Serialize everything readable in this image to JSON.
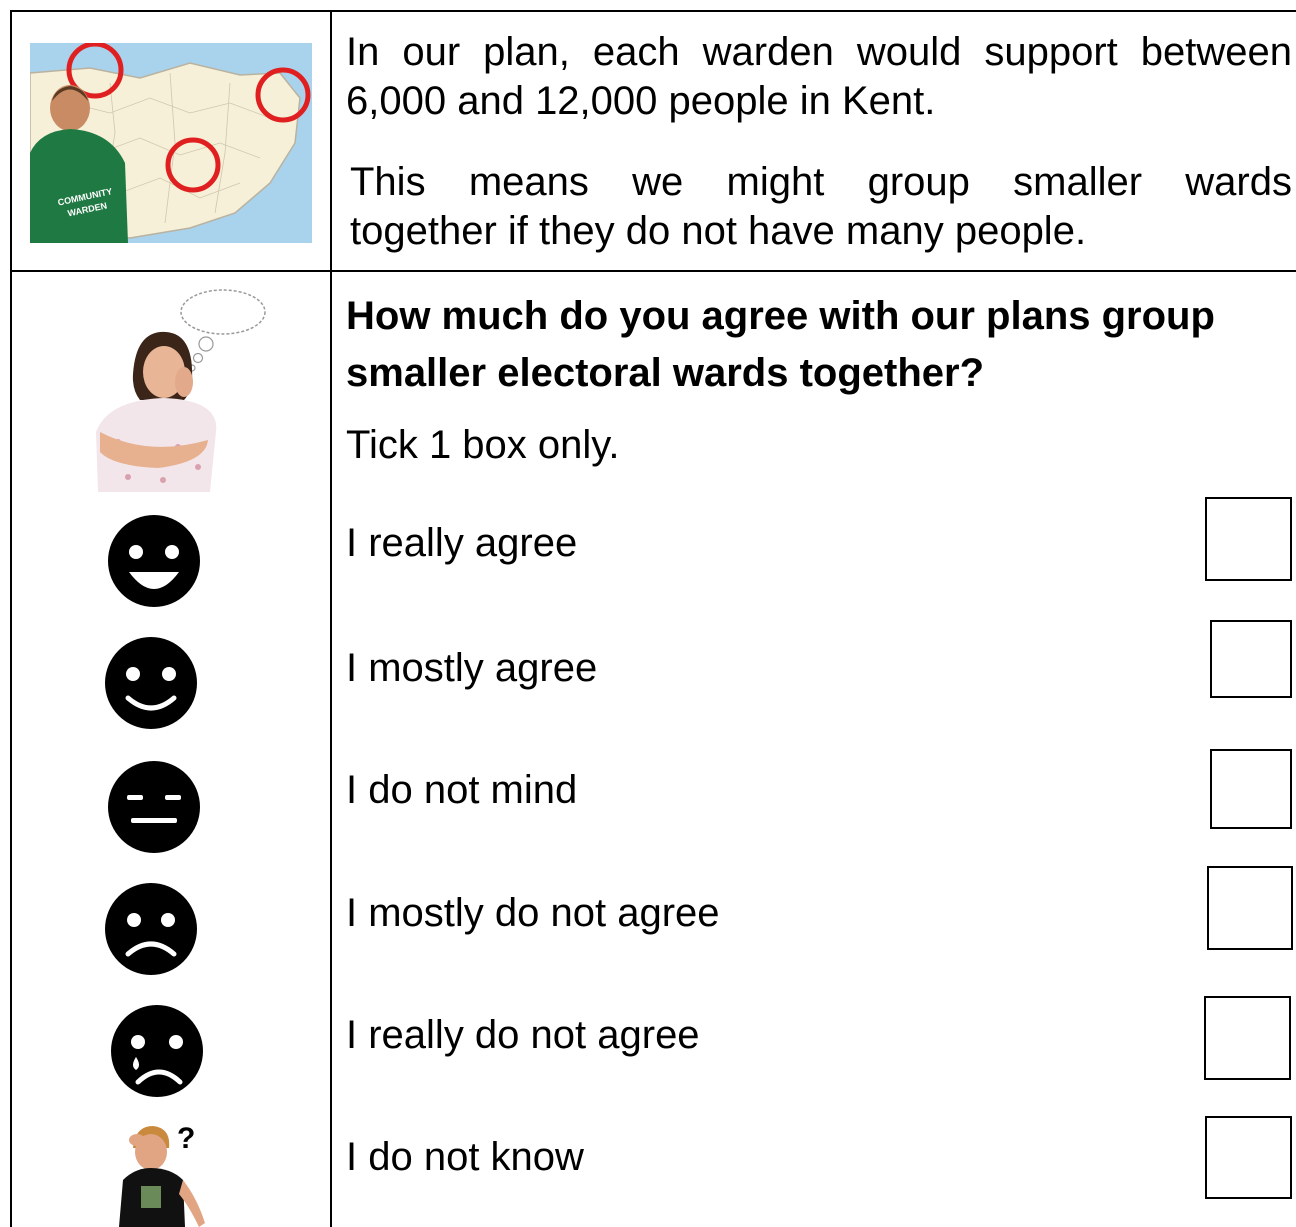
{
  "intro": {
    "line1a": "In our plan, each warden would support between",
    "line1b": "6,000 and 12,000 people in Kent.",
    "line2a": "This means we might group smaller wards",
    "line2b": "together if they do not have many people.",
    "jacket_text_1": "COMMUNITY",
    "jacket_text_2": "WARDEN"
  },
  "question": {
    "line1": "How much do you agree with our plans group",
    "line2": "smaller electoral wards together?",
    "instruction": "Tick 1 box only."
  },
  "options": [
    {
      "label": "I really agree",
      "face": "big-smile-face-icon"
    },
    {
      "label": "I mostly agree",
      "face": "smile-face-icon"
    },
    {
      "label": "I do not mind",
      "face": "neutral-face-icon"
    },
    {
      "label": "I mostly do not agree",
      "face": "frown-face-icon"
    },
    {
      "label": "I really do not agree",
      "face": "crying-face-icon"
    },
    {
      "label": "I do not know",
      "face": "confused-person-icon"
    }
  ]
}
